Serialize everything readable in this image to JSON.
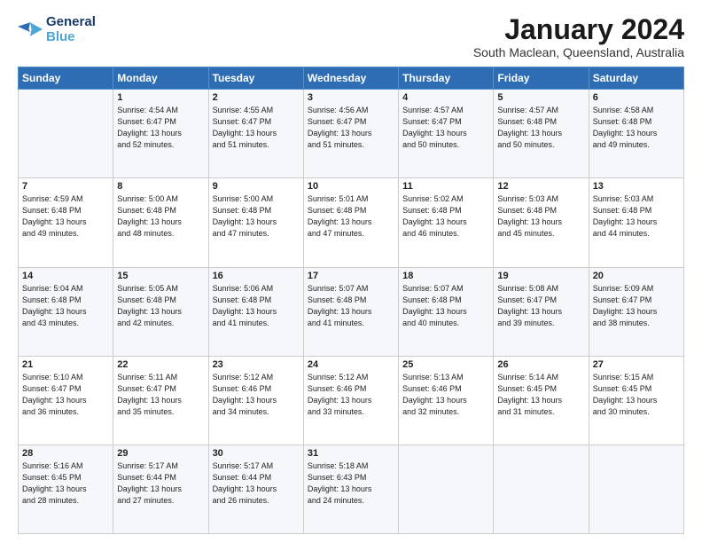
{
  "logo": {
    "line1": "General",
    "line2": "Blue"
  },
  "title": "January 2024",
  "location": "South Maclean, Queensland, Australia",
  "weekdays": [
    "Sunday",
    "Monday",
    "Tuesday",
    "Wednesday",
    "Thursday",
    "Friday",
    "Saturday"
  ],
  "weeks": [
    [
      {
        "day": "",
        "content": ""
      },
      {
        "day": "1",
        "content": "Sunrise: 4:54 AM\nSunset: 6:47 PM\nDaylight: 13 hours\nand 52 minutes."
      },
      {
        "day": "2",
        "content": "Sunrise: 4:55 AM\nSunset: 6:47 PM\nDaylight: 13 hours\nand 51 minutes."
      },
      {
        "day": "3",
        "content": "Sunrise: 4:56 AM\nSunset: 6:47 PM\nDaylight: 13 hours\nand 51 minutes."
      },
      {
        "day": "4",
        "content": "Sunrise: 4:57 AM\nSunset: 6:47 PM\nDaylight: 13 hours\nand 50 minutes."
      },
      {
        "day": "5",
        "content": "Sunrise: 4:57 AM\nSunset: 6:48 PM\nDaylight: 13 hours\nand 50 minutes."
      },
      {
        "day": "6",
        "content": "Sunrise: 4:58 AM\nSunset: 6:48 PM\nDaylight: 13 hours\nand 49 minutes."
      }
    ],
    [
      {
        "day": "7",
        "content": "Sunrise: 4:59 AM\nSunset: 6:48 PM\nDaylight: 13 hours\nand 49 minutes."
      },
      {
        "day": "8",
        "content": "Sunrise: 5:00 AM\nSunset: 6:48 PM\nDaylight: 13 hours\nand 48 minutes."
      },
      {
        "day": "9",
        "content": "Sunrise: 5:00 AM\nSunset: 6:48 PM\nDaylight: 13 hours\nand 47 minutes."
      },
      {
        "day": "10",
        "content": "Sunrise: 5:01 AM\nSunset: 6:48 PM\nDaylight: 13 hours\nand 47 minutes."
      },
      {
        "day": "11",
        "content": "Sunrise: 5:02 AM\nSunset: 6:48 PM\nDaylight: 13 hours\nand 46 minutes."
      },
      {
        "day": "12",
        "content": "Sunrise: 5:03 AM\nSunset: 6:48 PM\nDaylight: 13 hours\nand 45 minutes."
      },
      {
        "day": "13",
        "content": "Sunrise: 5:03 AM\nSunset: 6:48 PM\nDaylight: 13 hours\nand 44 minutes."
      }
    ],
    [
      {
        "day": "14",
        "content": "Sunrise: 5:04 AM\nSunset: 6:48 PM\nDaylight: 13 hours\nand 43 minutes."
      },
      {
        "day": "15",
        "content": "Sunrise: 5:05 AM\nSunset: 6:48 PM\nDaylight: 13 hours\nand 42 minutes."
      },
      {
        "day": "16",
        "content": "Sunrise: 5:06 AM\nSunset: 6:48 PM\nDaylight: 13 hours\nand 41 minutes."
      },
      {
        "day": "17",
        "content": "Sunrise: 5:07 AM\nSunset: 6:48 PM\nDaylight: 13 hours\nand 41 minutes."
      },
      {
        "day": "18",
        "content": "Sunrise: 5:07 AM\nSunset: 6:48 PM\nDaylight: 13 hours\nand 40 minutes."
      },
      {
        "day": "19",
        "content": "Sunrise: 5:08 AM\nSunset: 6:47 PM\nDaylight: 13 hours\nand 39 minutes."
      },
      {
        "day": "20",
        "content": "Sunrise: 5:09 AM\nSunset: 6:47 PM\nDaylight: 13 hours\nand 38 minutes."
      }
    ],
    [
      {
        "day": "21",
        "content": "Sunrise: 5:10 AM\nSunset: 6:47 PM\nDaylight: 13 hours\nand 36 minutes."
      },
      {
        "day": "22",
        "content": "Sunrise: 5:11 AM\nSunset: 6:47 PM\nDaylight: 13 hours\nand 35 minutes."
      },
      {
        "day": "23",
        "content": "Sunrise: 5:12 AM\nSunset: 6:46 PM\nDaylight: 13 hours\nand 34 minutes."
      },
      {
        "day": "24",
        "content": "Sunrise: 5:12 AM\nSunset: 6:46 PM\nDaylight: 13 hours\nand 33 minutes."
      },
      {
        "day": "25",
        "content": "Sunrise: 5:13 AM\nSunset: 6:46 PM\nDaylight: 13 hours\nand 32 minutes."
      },
      {
        "day": "26",
        "content": "Sunrise: 5:14 AM\nSunset: 6:45 PM\nDaylight: 13 hours\nand 31 minutes."
      },
      {
        "day": "27",
        "content": "Sunrise: 5:15 AM\nSunset: 6:45 PM\nDaylight: 13 hours\nand 30 minutes."
      }
    ],
    [
      {
        "day": "28",
        "content": "Sunrise: 5:16 AM\nSunset: 6:45 PM\nDaylight: 13 hours\nand 28 minutes."
      },
      {
        "day": "29",
        "content": "Sunrise: 5:17 AM\nSunset: 6:44 PM\nDaylight: 13 hours\nand 27 minutes."
      },
      {
        "day": "30",
        "content": "Sunrise: 5:17 AM\nSunset: 6:44 PM\nDaylight: 13 hours\nand 26 minutes."
      },
      {
        "day": "31",
        "content": "Sunrise: 5:18 AM\nSunset: 6:43 PM\nDaylight: 13 hours\nand 24 minutes."
      },
      {
        "day": "",
        "content": ""
      },
      {
        "day": "",
        "content": ""
      },
      {
        "day": "",
        "content": ""
      }
    ]
  ]
}
